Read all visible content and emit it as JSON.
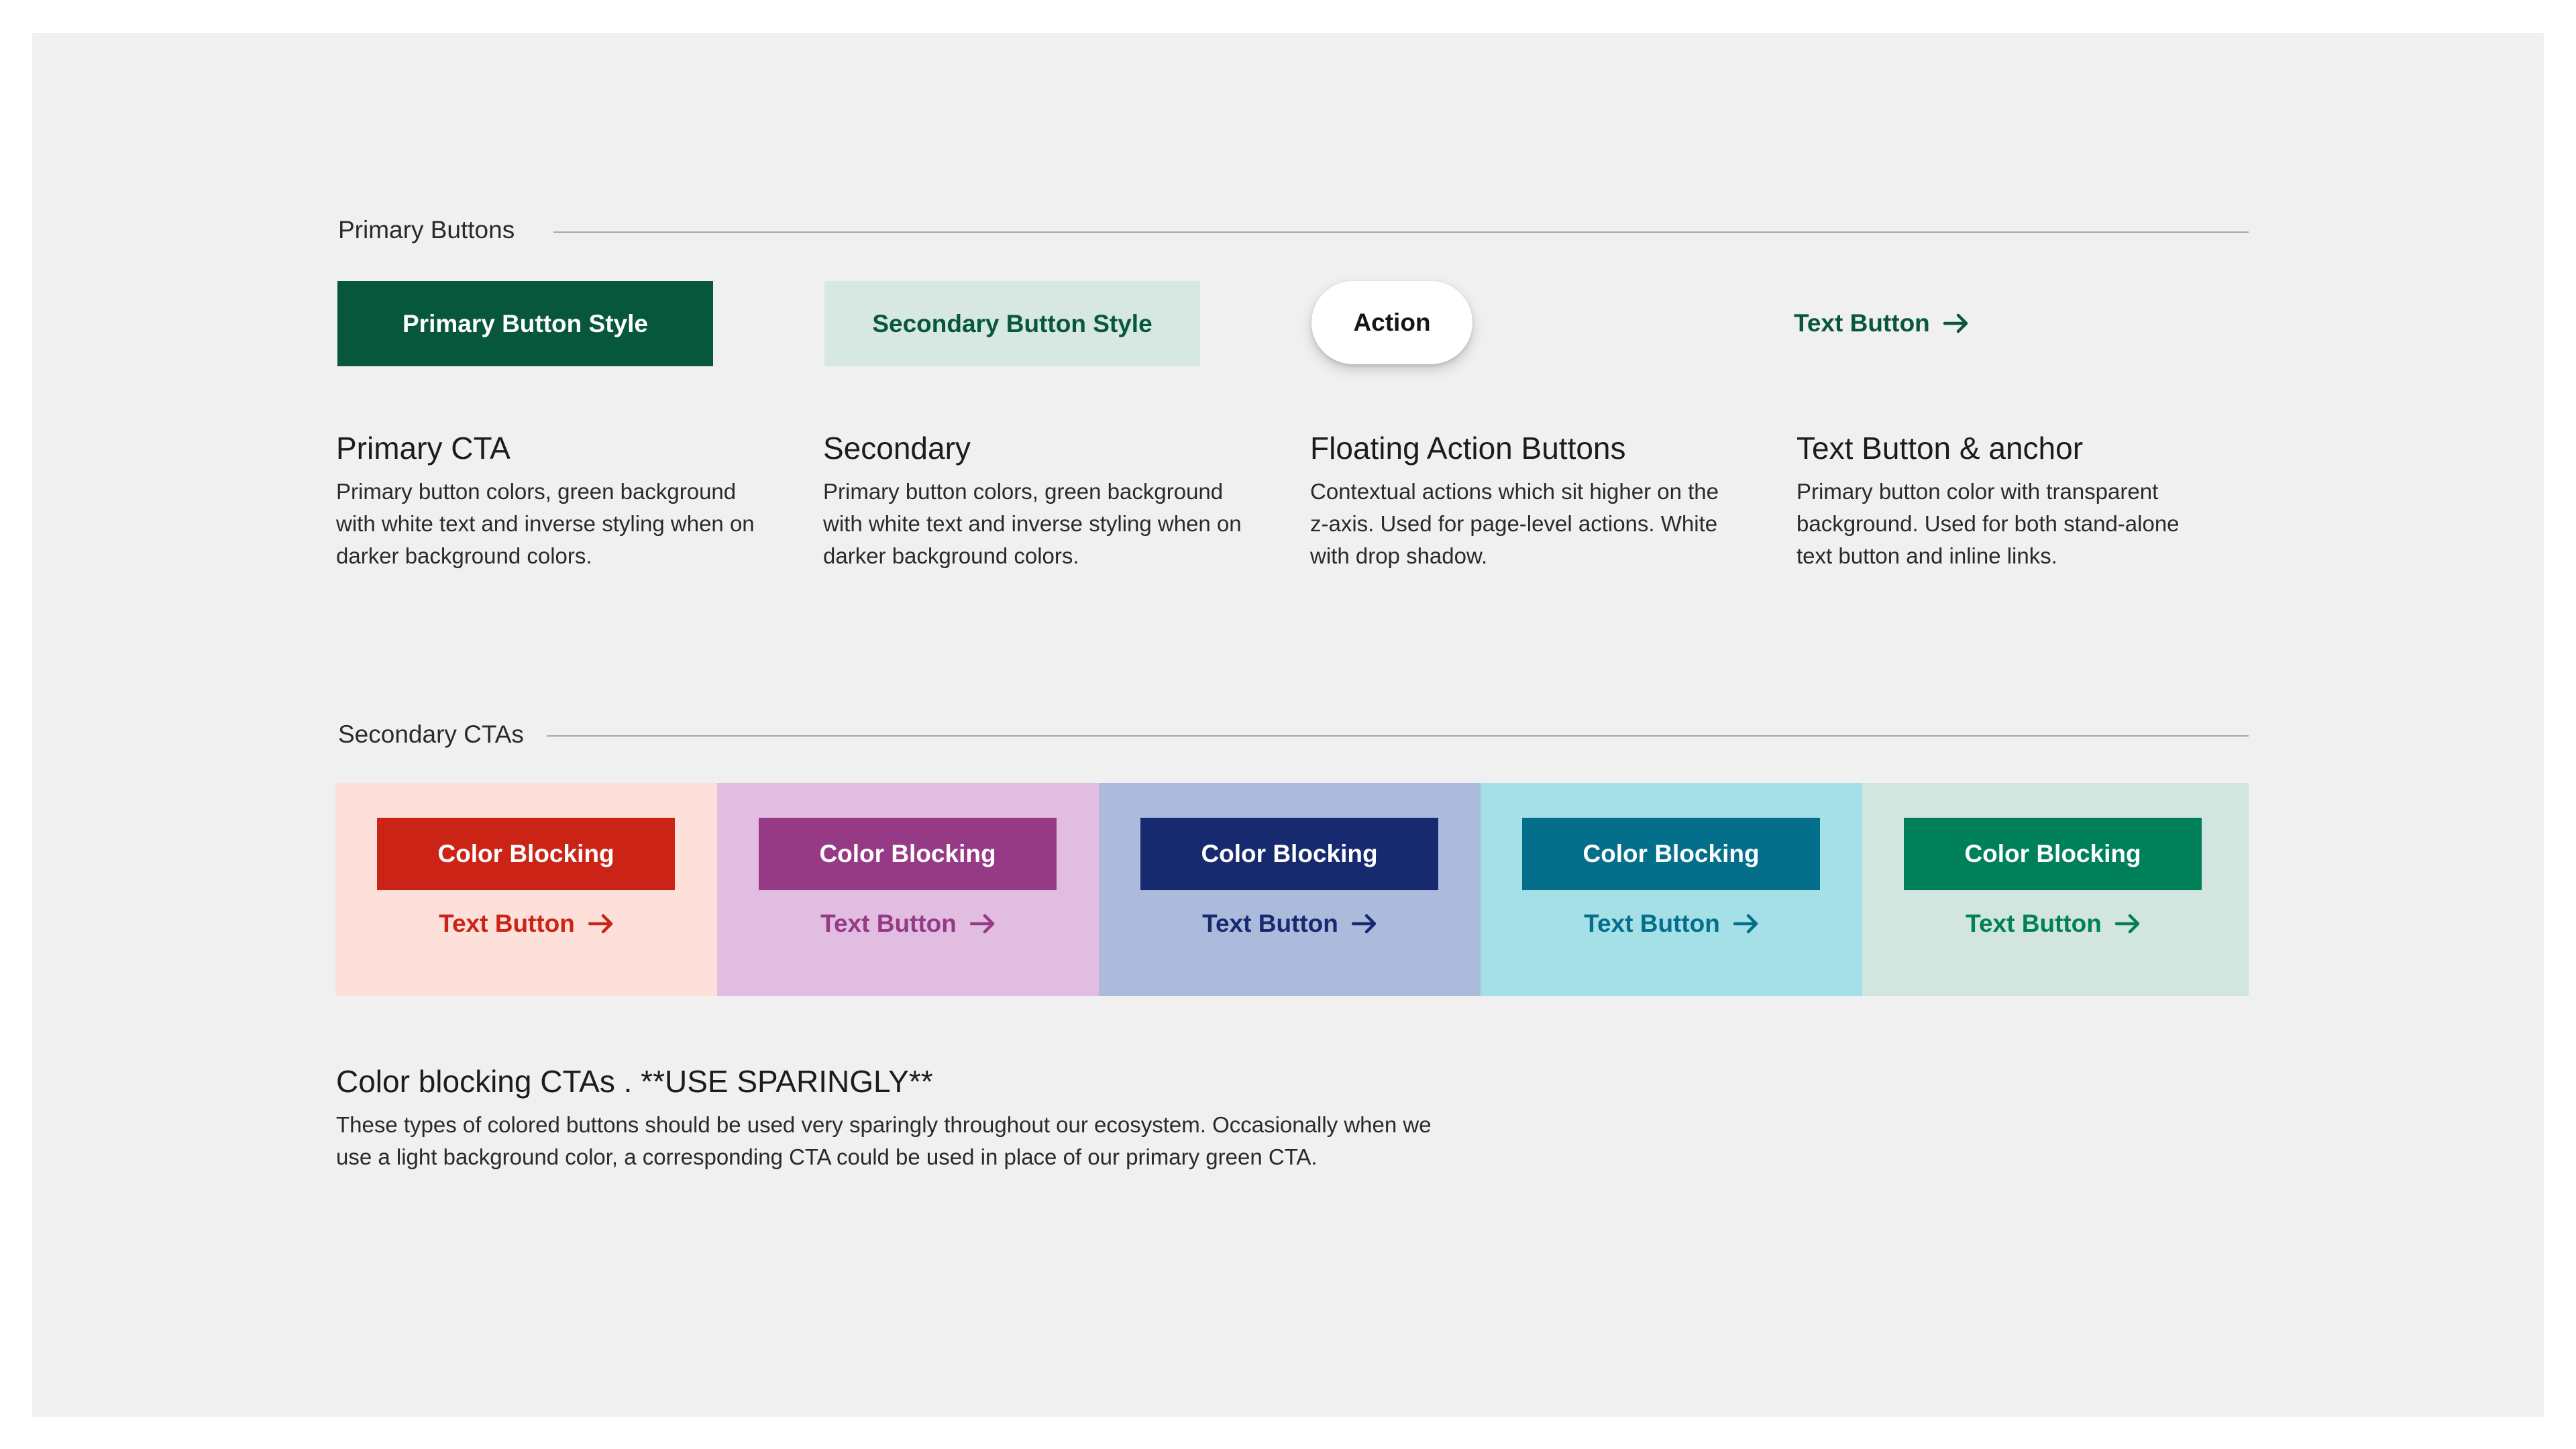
{
  "primary_section": {
    "label": "Primary Buttons",
    "buttons": {
      "primary": "Primary Button Style",
      "secondary": "Secondary Button Style",
      "action": "Action",
      "text": "Text Button"
    },
    "cards": [
      {
        "title": "Primary CTA",
        "lines": [
          "Primary button colors, green background",
          "with white text and inverse styling when on",
          "darker background colors."
        ]
      },
      {
        "title": "Secondary",
        "lines": [
          "Primary button colors, green background",
          "with white text and inverse styling when on",
          "darker background colors."
        ]
      },
      {
        "title": "Floating Action Buttons",
        "lines": [
          "Contextual actions which sit higher on the",
          "z-axis. Used for page-level actions. White",
          "with drop shadow."
        ]
      },
      {
        "title": "Text Button & anchor",
        "lines": [
          "Primary button color with transparent",
          "background. Used for both stand-alone",
          "text button and inline links."
        ]
      }
    ]
  },
  "secondary_section": {
    "label": "Secondary CTAs",
    "panels": [
      {
        "button": "Color Blocking",
        "text_button": "Text Button",
        "bg": "#fde0da",
        "button_color": "#cb2416",
        "text_color": "#cb2416"
      },
      {
        "button": "Color Blocking",
        "text_button": "Text Button",
        "bg": "#e1bde2",
        "button_color": "#973a85",
        "text_color": "#973a85"
      },
      {
        "button": "Color Blocking",
        "text_button": "Text Button",
        "bg": "#acbbdb",
        "button_color": "#172a6f",
        "text_color": "#172a6f"
      },
      {
        "button": "Color Blocking",
        "text_button": "Text Button",
        "bg": "#a6e0e7",
        "button_color": "#036f8b",
        "text_color": "#036f8b"
      },
      {
        "button": "Color Blocking",
        "text_button": "Text Button",
        "bg": "#d2e6df",
        "button_color": "#008059",
        "text_color": "#008059"
      }
    ],
    "note": {
      "title": "Color blocking CTAs . **USE SPARINGLY**",
      "lines": [
        "These types of colored buttons should be used very sparingly throughout our ecosystem. Occasionally when we",
        "use a light background color, a corresponding CTA could be used in place of our primary green CTA."
      ]
    }
  },
  "colors": {
    "brand_green": "#07573c",
    "secondary_tint": "#d7e8e2",
    "canvas": "#f0f0f0"
  },
  "icons": {
    "text_button_icon": "arrow-right-icon"
  }
}
